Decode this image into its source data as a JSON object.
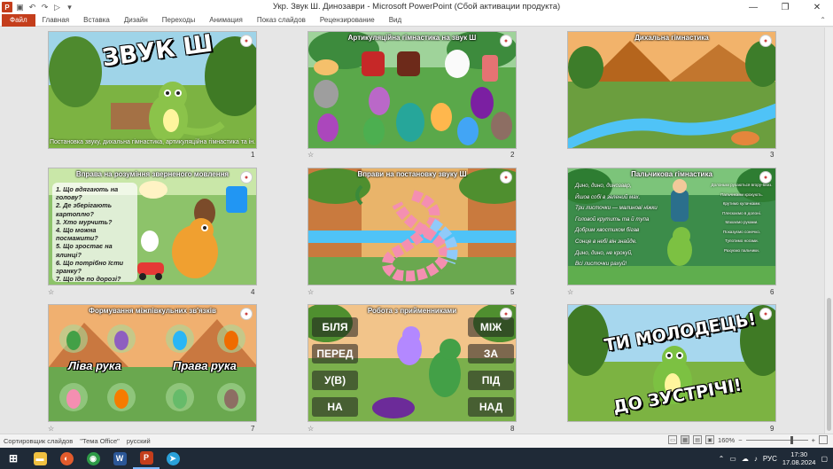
{
  "window": {
    "app_icon": "P",
    "title": "Укр. Звук Ш. Динозаври  -  Microsoft PowerPoint (Сбой активации продукта)",
    "controls": [
      "minimize-icon",
      "restore-icon",
      "close-icon"
    ],
    "minimize_glyph": "—",
    "restore_glyph": "❐",
    "close_glyph": "✕"
  },
  "ribbon": {
    "tabs": [
      "Файл",
      "Главная",
      "Вставка",
      "Дизайн",
      "Переходы",
      "Анимация",
      "Показ слайдов",
      "Рецензирование",
      "Вид"
    ],
    "collapse_glyph": "⌃"
  },
  "slides": [
    {
      "number": "1",
      "title": "ЗВУК Ш",
      "caption": "Постановка звуку, дихальна гімнастика, артикуляційна гімнастика та ін."
    },
    {
      "number": "2",
      "title": "Артикуляційна гімнастика на звук Ш"
    },
    {
      "number": "3",
      "title": "Дихальна гімнастика"
    },
    {
      "number": "4",
      "title": "Вправа на розуміння зверненого мовлення",
      "questions": [
        "1. Що вдягають на голову?",
        "2. Де зберігають картоплю?",
        "3. Хто мурчить?",
        "4. Що можна посмажити?",
        "5. Що зростає на ялинці?",
        "6. Що потрібно їсти зранку?",
        "7. Що їде по дорозі?"
      ]
    },
    {
      "number": "5",
      "title": "Вправи на постановку звуку Ш"
    },
    {
      "number": "6",
      "title": "Пальчикова гімнастика",
      "verse": [
        "Дино, дино, динозавр,",
        "Йшов собі в зелений мах.",
        "Три листочки — малинові ніжки",
        "Головой крутить та й тупа",
        "Добрим хвостиком бігав",
        "Сонце в небі він знайде.",
        "Дино, дино, не крокуй,",
        "Всі листочки рахуй!"
      ],
      "hints": [
        "Долоньки рухаються вгору-вниз.",
        "Пальчиками крокують.",
        "Крутимо кулачками.",
        "Плескаємо в долоні.",
        "Махаємо руками.",
        "Показуємо сонечко.",
        "Тупотимо ногами.",
        "Рахуємо пальчики."
      ]
    },
    {
      "number": "7",
      "title": "Формування міжпівкульних зв'язків",
      "left_label": "Ліва рука",
      "right_label": "Права рука"
    },
    {
      "number": "8",
      "title": "Робота з прийменниками",
      "left_words": [
        "БІЛЯ",
        "ПЕРЕД",
        "У(В)",
        "НА"
      ],
      "right_words": [
        "МІЖ",
        "ЗА",
        "ПІД",
        "НАД"
      ]
    },
    {
      "number": "9",
      "title_line1": "ТИ МОЛОДЕЦЬ!",
      "title_line2": "ДО ЗУСТРІЧІ!"
    }
  ],
  "anim_marker": "☆",
  "logo_glyph": "●",
  "statusbar": {
    "view_name": "Сортировщик слайдов",
    "theme": "\"Тема Office\"",
    "language": "русский",
    "zoom": "160%",
    "zoom_minus": "−",
    "zoom_plus": "+",
    "view_glyphs": [
      "▭",
      "▦",
      "▤",
      "▣"
    ]
  },
  "taskbar": {
    "language": "РУС",
    "time": "17:30",
    "date": "17.08.2024",
    "apps": [
      {
        "glyph": "⊞",
        "color": "#1f2a37"
      },
      {
        "glyph": "▬",
        "color": "#f0c040"
      },
      {
        "glyph": "◐",
        "color": "#e25b2c"
      },
      {
        "glyph": "◉",
        "color": "#2e9b47"
      },
      {
        "glyph": "W",
        "color": "#2b5797"
      },
      {
        "glyph": "P",
        "color": "#c43e1c"
      },
      {
        "glyph": "➤",
        "color": "#2aa1da"
      }
    ],
    "tray_glyphs": [
      "⌃",
      "▭",
      "☁",
      "♪"
    ],
    "notification_glyph": "▢"
  },
  "colors": {
    "accent": "#c43e1c",
    "taskbar": "#1f2a37"
  }
}
